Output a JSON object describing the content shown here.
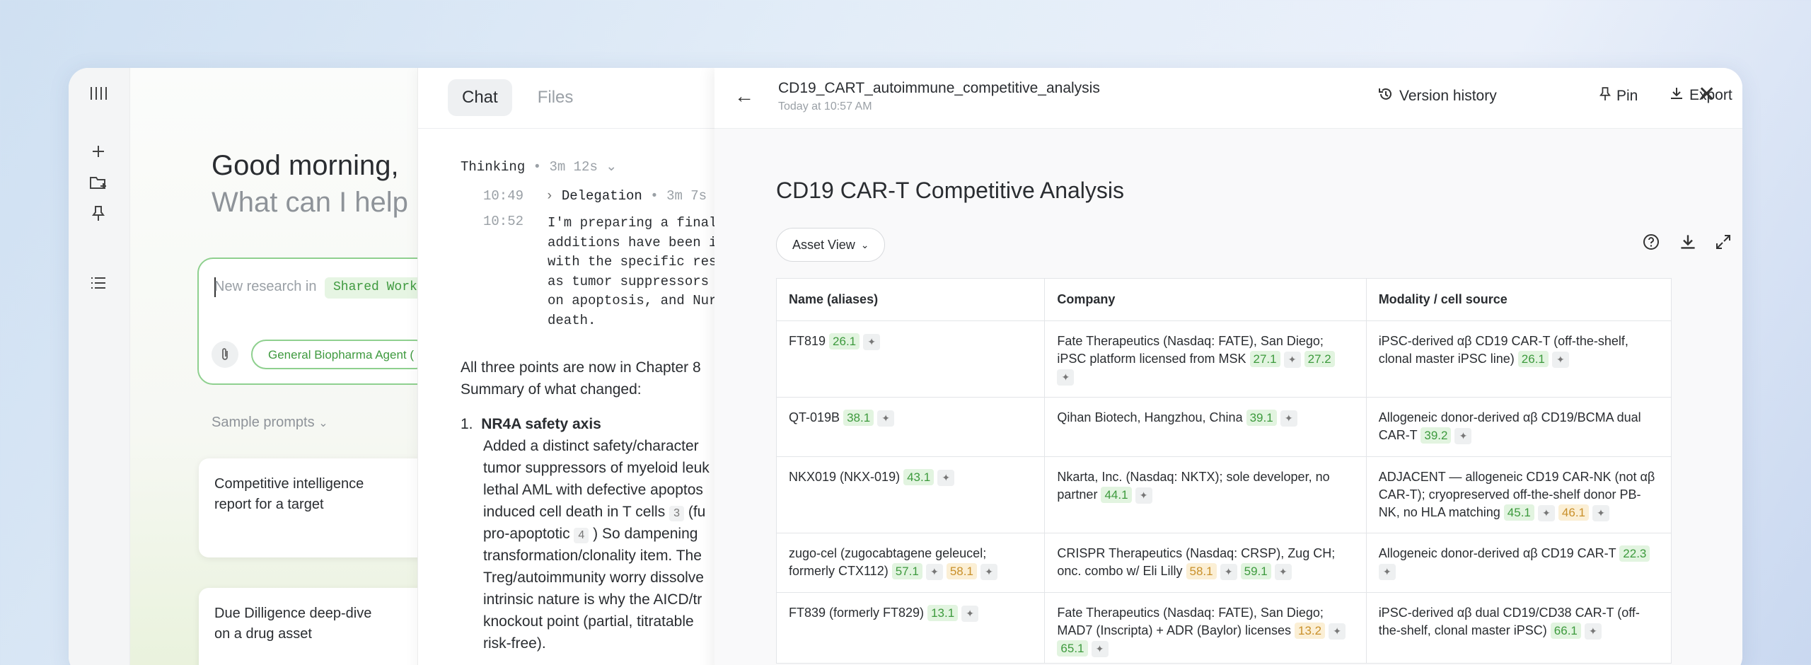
{
  "rail": {
    "icons": [
      "sidebar-toggle-icon",
      "plus-icon",
      "folder-add-icon",
      "pin-icon",
      "list-icon"
    ]
  },
  "home": {
    "greeting": "Good morning,",
    "prompt": "What can I help",
    "input_placeholder": "New research in",
    "workspace_chip": "Shared Works",
    "agent_label": "General Biopharma Agent (",
    "samples_label": "Sample prompts",
    "cards": [
      {
        "text": "Competitive intelligence report for a target"
      },
      {
        "text": "Due Dilligence deep-dive on a drug asset"
      }
    ]
  },
  "chat": {
    "tabs": [
      "Chat",
      "Files"
    ],
    "thinking_label": "Thinking",
    "thinking_time": "3m 12s",
    "rows": [
      {
        "time": "10:49",
        "label": "Delegation",
        "dur": "3m 7s"
      },
      {
        "time": "10:52"
      }
    ],
    "mono_lines": [
      "I'm preparing a final",
      "additions have been i",
      "with the specific res",
      "as tumor suppressors",
      "on apoptosis, and Nur",
      "death."
    ],
    "para_lines": [
      "All three points are now in Chapter 8",
      "Summary of what changed:"
    ],
    "list_num": "1.",
    "list_title": "NR4A safety axis",
    "list_lines": [
      "Added a distinct safety/character",
      "tumor suppressors of myeloid leuk",
      "lethal AML with defective apoptos",
      "induced cell death in T cells",
      "pro-apoptotic",
      ") So dampening",
      "transformation/clonality item. The",
      "Treg/autoimmunity worry dissolve",
      "intrinsic nature is why the AICD/tr",
      "knockout point (partial, titratable",
      "risk-free)."
    ],
    "cite3": "3",
    "cite3_after": "(fu",
    "cite4": "4"
  },
  "doc": {
    "file_title": "CD19_CART_autoimmune_competitive_analysis",
    "timestamp": "Today at 10:57 AM",
    "actions": {
      "version": "Version history",
      "pin": "Pin",
      "export": "Export"
    },
    "heading": "CD19 CAR-T Competitive Analysis",
    "view_label": "Asset View",
    "table": {
      "headers": [
        "Name (aliases)",
        "Company",
        "Modality / cell source"
      ],
      "rows": [
        {
          "name": "FT819",
          "name_scores": [
            {
              "v": "26.1",
              "c": "g"
            }
          ],
          "company": "Fate Therapeutics (Nasdaq: FATE), San Diego; iPSC platform licensed from MSK",
          "company_scores": [
            {
              "v": "27.1",
              "c": "g"
            },
            {
              "v": "27.2",
              "c": "g"
            }
          ],
          "modality": "iPSC-derived αβ CD19 CAR-T (off-the-shelf, clonal master iPSC line)",
          "modality_scores": [
            {
              "v": "26.1",
              "c": "g"
            }
          ]
        },
        {
          "name": "QT-019B",
          "name_scores": [
            {
              "v": "38.1",
              "c": "g"
            }
          ],
          "company": "Qihan Biotech, Hangzhou, China",
          "company_scores": [
            {
              "v": "39.1",
              "c": "g"
            }
          ],
          "modality": "Allogeneic donor-derived αβ CD19/BCMA dual CAR-T",
          "modality_scores": [
            {
              "v": "39.2",
              "c": "g"
            }
          ]
        },
        {
          "name": "NKX019 (NKX-019)",
          "name_scores": [
            {
              "v": "43.1",
              "c": "g"
            }
          ],
          "company": "Nkarta, Inc. (Nasdaq: NKTX); sole developer, no partner",
          "company_scores": [
            {
              "v": "44.1",
              "c": "g"
            }
          ],
          "modality": "ADJACENT — allogeneic CD19 CAR-NK (not αβ CAR-T); cryopreserved off-the-shelf donor PB-NK, no HLA matching",
          "modality_scores": [
            {
              "v": "45.1",
              "c": "g"
            },
            {
              "v": "46.1",
              "c": "y"
            }
          ]
        },
        {
          "name": "zugo-cel (zugocabtagene geleucel; formerly CTX112)",
          "name_scores": [
            {
              "v": "57.1",
              "c": "g"
            },
            {
              "v": "58.1",
              "c": "y"
            }
          ],
          "company": "CRISPR Therapeutics (Nasdaq: CRSP), Zug CH; onc. combo w/ Eli Lilly",
          "company_scores": [
            {
              "v": "58.1",
              "c": "y"
            },
            {
              "v": "59.1",
              "c": "g"
            }
          ],
          "modality": "Allogeneic donor-derived αβ CD19 CAR-T",
          "modality_scores": [
            {
              "v": "22.3",
              "c": "g"
            }
          ]
        },
        {
          "name": "FT839 (formerly FT829)",
          "name_scores": [
            {
              "v": "13.1",
              "c": "g"
            }
          ],
          "company": "Fate Therapeutics (Nasdaq: FATE), San Diego; MAD7 (Inscripta) + ADR (Baylor) licenses",
          "company_scores": [
            {
              "v": "13.2",
              "c": "y"
            },
            {
              "v": "65.1",
              "c": "g"
            }
          ],
          "modality": "iPSC-derived αβ dual CD19/CD38 CAR-T (off-the-shelf, clonal master iPSC)",
          "modality_scores": [
            {
              "v": "66.1",
              "c": "g"
            }
          ]
        }
      ]
    }
  }
}
